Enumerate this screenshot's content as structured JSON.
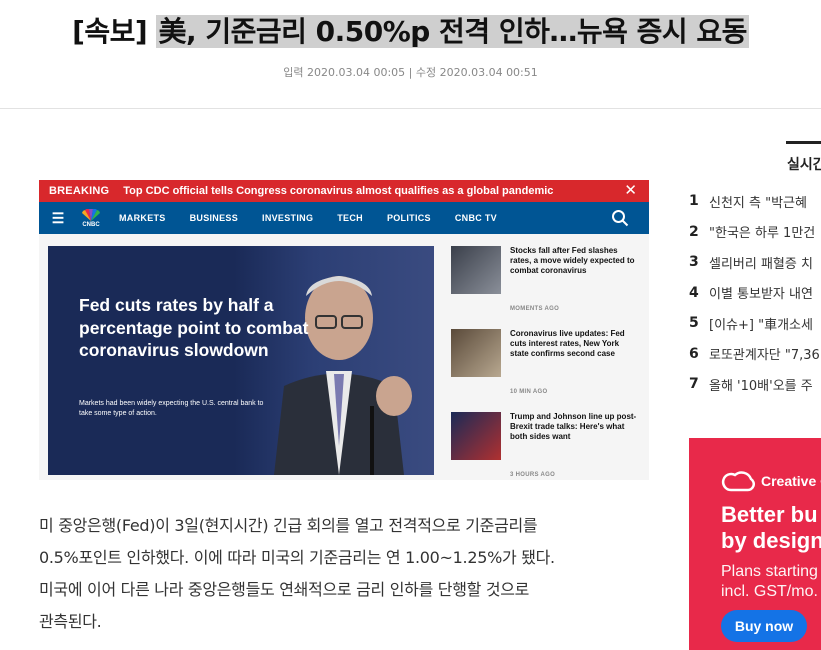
{
  "article": {
    "headline_prefix": "[속보]",
    "headline_highlight": "美, 기준금리 0.50%p 전격 인하…뉴욕 증시 요동",
    "meta": "입력 2020.03.04 00:05 | 수정 2020.03.04 00:51",
    "body": [
      "미 중앙은행(Fed)이 3일(현지시간) 긴급 회의를 열고 전격적으로 기준금리를",
      "0.5%포인트 인하했다. 이에 따라 미국의 기준금리는 연 1.00~1.25%가 됐다.",
      "미국에 이어 다른 나라 중앙은행들도 연쇄적으로 금리 인하를 단행할 것으로",
      "관측된다."
    ]
  },
  "cnbc": {
    "breaking_tag": "BREAKING",
    "breaking_text": "Top CDC official tells Congress coronavirus almost qualifies as a global pandemic",
    "close": "✕",
    "logo_word": "CNBC",
    "nav": [
      "MARKETS",
      "BUSINESS",
      "INVESTING",
      "TECH",
      "POLITICS",
      "CNBC TV"
    ],
    "hero_title": "Fed cuts rates by half a percentage point to combat coronavirus slowdown",
    "hero_sub": "Markets had been widely expecting the U.S. central bank to take some type of action.",
    "side": [
      {
        "title": "Stocks fall after Fed slashes rates, a move widely expected to combat coronavirus",
        "time": "MOMENTS AGO"
      },
      {
        "title": "Coronavirus live updates: Fed cuts interest rates, New York state confirms second case",
        "time": "10 MIN AGO"
      },
      {
        "title": "Trump and Johnson line up post-Brexit trade talks: Here's what both sides want",
        "time": "3 HOURS AGO"
      }
    ]
  },
  "sidebar": {
    "tab_label": "실시간",
    "ranking": [
      {
        "n": "1",
        "t": "신천지 측 \"박근혜"
      },
      {
        "n": "2",
        "t": "\"한국은 하루 1만건"
      },
      {
        "n": "3",
        "t": "셀리버리 패혈증 치"
      },
      {
        "n": "4",
        "t": "이별 통보받자 내연"
      },
      {
        "n": "5",
        "t": "[이슈+] \"車개소세"
      },
      {
        "n": "6",
        "t": "로또관계자단 \"7,36"
      },
      {
        "n": "7",
        "t": "올해 '10배'오를 주"
      }
    ]
  },
  "ad": {
    "brand": "Creative Cloud",
    "headline_1": "Better bu",
    "headline_2": "by design",
    "line_1": "Plans starting",
    "line_2": "incl. GST/mo.",
    "cta": "Buy now",
    "colors": {
      "bg": "#e8294a",
      "cta": "#1473e6"
    }
  }
}
